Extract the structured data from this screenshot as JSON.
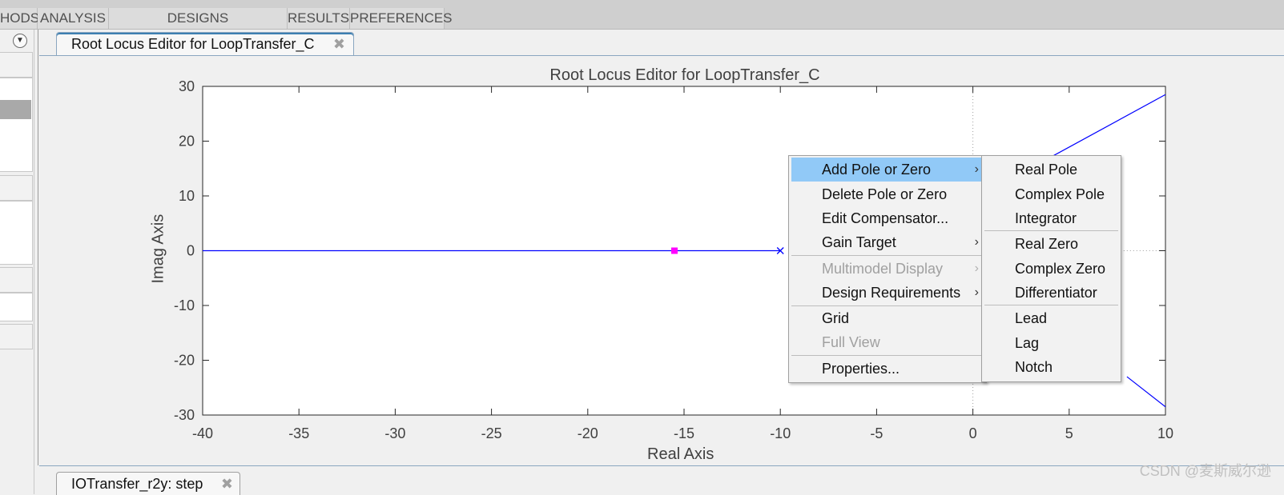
{
  "toolstrip": {
    "tabs": [
      "HODS",
      "ANALYSIS",
      "DESIGNS",
      "RESULTS",
      "PREFERENCES"
    ]
  },
  "document": {
    "tab_title": "Root Locus Editor for LoopTransfer_C",
    "bottom_tab_title": "IOTransfer_r2y: step"
  },
  "chart_data": {
    "type": "line",
    "title": "Root Locus Editor for LoopTransfer_C",
    "xlabel": "Real Axis",
    "ylabel": "Imag Axis",
    "xlim": [
      -40,
      10
    ],
    "ylim": [
      -30,
      30
    ],
    "xticks": [
      -40,
      -35,
      -30,
      -25,
      -20,
      -15,
      -10,
      -5,
      0,
      5,
      10
    ],
    "yticks": [
      30,
      20,
      10,
      0,
      -10,
      -20,
      -30
    ],
    "grid": false,
    "colors": {
      "locus": "#0000ff",
      "gain_marker": "#ff00ff",
      "axes": "#262626",
      "dotted": "#a0a0a0"
    },
    "series": [
      {
        "values": [
          [
            -40,
            0
          ],
          [
            -10,
            0
          ]
        ]
      },
      {
        "values": [
          [
            4,
            17
          ],
          [
            10,
            28.5
          ]
        ]
      },
      {
        "values": [
          [
            8,
            -23
          ],
          [
            10,
            -28.5
          ]
        ]
      }
    ],
    "poles": [
      [
        -10,
        0
      ]
    ],
    "closed_loop_markers": [
      [
        -15.5,
        0
      ]
    ],
    "dotted_lines": {
      "vertical_x": 0,
      "horizontal_from_x": 5,
      "horizontal_y": 0
    }
  },
  "context_menu": {
    "items": [
      {
        "label": "Add Pole or Zero",
        "submenu": true,
        "highlighted": true,
        "disabled": false
      },
      {
        "label": "Delete Pole or Zero",
        "submenu": false,
        "highlighted": false,
        "disabled": false
      },
      {
        "label": "Edit Compensator...",
        "submenu": false,
        "highlighted": false,
        "disabled": false
      },
      {
        "label": "Gain Target",
        "submenu": true,
        "highlighted": false,
        "disabled": false
      },
      {
        "label": "Multimodel Display",
        "submenu": true,
        "highlighted": false,
        "disabled": true
      },
      {
        "label": "Design Requirements",
        "submenu": true,
        "highlighted": false,
        "disabled": false
      },
      {
        "label": "Grid",
        "submenu": false,
        "highlighted": false,
        "disabled": false
      },
      {
        "label": "Full View",
        "submenu": false,
        "highlighted": false,
        "disabled": true
      },
      {
        "label": "Properties...",
        "submenu": false,
        "highlighted": false,
        "disabled": false
      }
    ],
    "arrow": "›"
  },
  "submenu": {
    "items": [
      "Real Pole",
      "Complex Pole",
      "Integrator",
      "Real Zero",
      "Complex Zero",
      "Differentiator",
      "Lead",
      "Lag",
      "Notch"
    ]
  },
  "watermark": "CSDN @麦斯威尔逊"
}
